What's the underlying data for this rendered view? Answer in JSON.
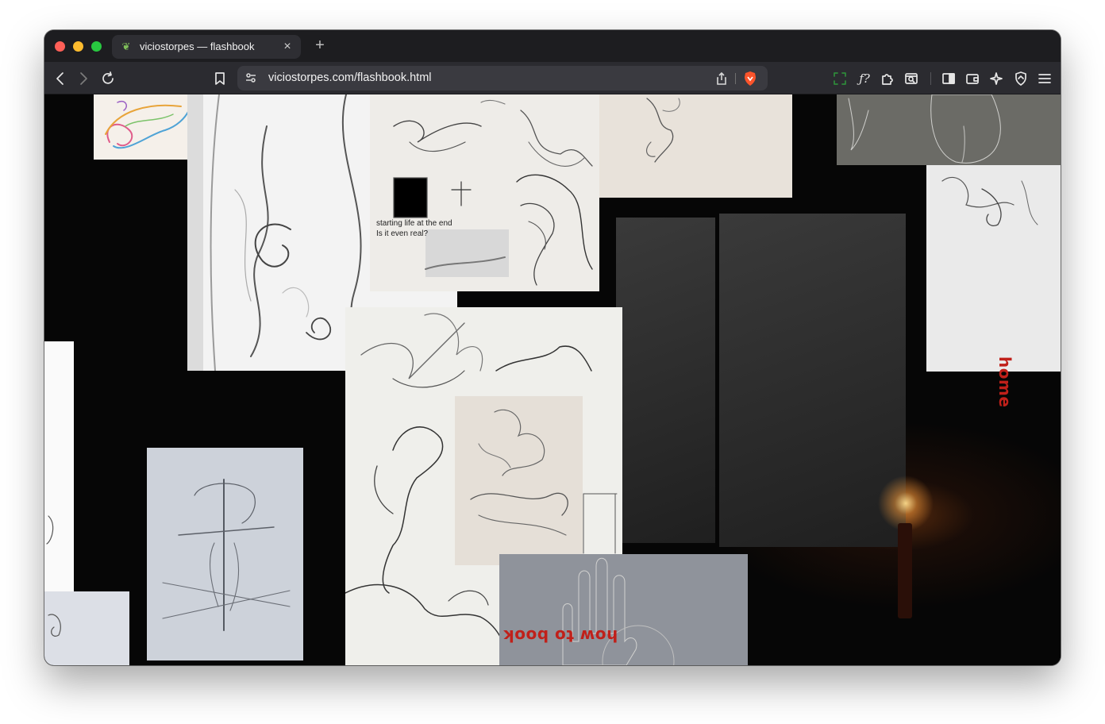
{
  "browser": {
    "tab": {
      "title": "viciostorpes — flashbook",
      "favicon": "leaf-favicon",
      "close_glyph": "×"
    },
    "new_tab_glyph": "+",
    "address_bar": {
      "url": "viciostorpes.com/flashbook.html"
    },
    "icons": [
      "back-icon",
      "forward-icon",
      "reload-icon",
      "bookmark-icon",
      "site-settings-icon",
      "share-icon",
      "brave-shields-icon",
      "screenshot-icon",
      "formula-icon",
      "extensions-icon",
      "tab-search-icon",
      "sidebar-icon",
      "wallet-icon",
      "leo-ai-icon",
      "vpn-icon",
      "menu-icon"
    ]
  },
  "page": {
    "collage_text": {
      "line1": "starting life at the end",
      "line2": "Is it even real?"
    },
    "nav": {
      "home": "home",
      "how_to_book": "how to book"
    },
    "colors": {
      "accent_red": "#c0201a",
      "background": "#050505"
    }
  }
}
